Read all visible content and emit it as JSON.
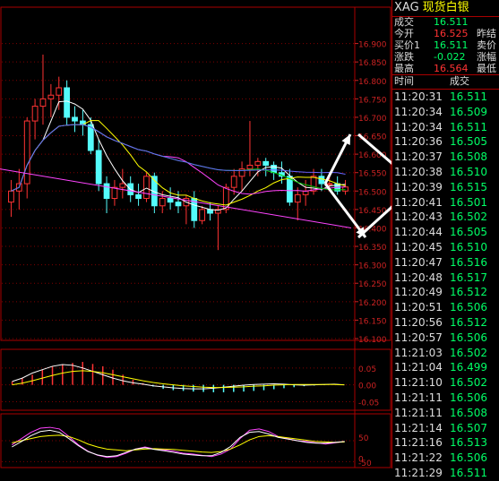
{
  "header": {
    "symbol": "XAG",
    "name": "现货白银"
  },
  "quote": [
    {
      "label": "成交",
      "value": "16.511",
      "color": "#00ff66",
      "label2": ""
    },
    {
      "label": "今开",
      "value": "16.525",
      "color": "#ff3333",
      "label2": "昨结"
    },
    {
      "label": "买价1",
      "value": "16.511",
      "color": "#00ff66",
      "label2": "卖价"
    },
    {
      "label": "涨跌",
      "value": "-0.022",
      "color": "#00ff66",
      "label2": "涨幅"
    },
    {
      "label": "最高",
      "value": "16.564",
      "color": "#ff3333",
      "label2": "最低"
    }
  ],
  "trades_header": {
    "time": "时间",
    "price": "成交"
  },
  "trades": [
    {
      "time": "11:20:31",
      "price": "16.511",
      "color": "#00ff66"
    },
    {
      "time": "11:20:34",
      "price": "16.509",
      "color": "#00ff66"
    },
    {
      "time": "11:20:34",
      "price": "16.511",
      "color": "#00ff66"
    },
    {
      "time": "11:20:36",
      "price": "16.505",
      "color": "#00ff66"
    },
    {
      "time": "11:20:37",
      "price": "16.508",
      "color": "#00ff66"
    },
    {
      "time": "11:20:38",
      "price": "16.510",
      "color": "#00ff66"
    },
    {
      "time": "11:20:39",
      "price": "16.515",
      "color": "#00ff66"
    },
    {
      "time": "11:20:41",
      "price": "16.501",
      "color": "#00ff66"
    },
    {
      "time": "11:20:43",
      "price": "16.502",
      "color": "#00ff66"
    },
    {
      "time": "11:20:44",
      "price": "16.505",
      "color": "#00ff66"
    },
    {
      "time": "11:20:45",
      "price": "16.510",
      "color": "#00ff66"
    },
    {
      "time": "11:20:47",
      "price": "16.516",
      "color": "#00ff66"
    },
    {
      "time": "11:20:48",
      "price": "16.517",
      "color": "#00ff66"
    },
    {
      "time": "11:20:49",
      "price": "16.512",
      "color": "#00ff66"
    },
    {
      "time": "11:20:51",
      "price": "16.506",
      "color": "#00ff66"
    },
    {
      "time": "11:20:56",
      "price": "16.512",
      "color": "#00ff66"
    },
    {
      "time": "11:20:57",
      "price": "16.506",
      "color": "#00ff66"
    },
    {
      "time": "11:21:03",
      "price": "16.502",
      "color": "#00ff66"
    },
    {
      "time": "11:21:04",
      "price": "16.499",
      "color": "#00ff66"
    },
    {
      "time": "11:21:10",
      "price": "16.502",
      "color": "#00ff66"
    },
    {
      "time": "11:21:11",
      "price": "16.506",
      "color": "#00ff66"
    },
    {
      "time": "11:21:11",
      "price": "16.508",
      "color": "#00ff66"
    },
    {
      "time": "11:21:14",
      "price": "16.507",
      "color": "#00ff66"
    },
    {
      "time": "11:21:16",
      "price": "16.513",
      "color": "#00ff66"
    },
    {
      "time": "11:21:22",
      "price": "16.506",
      "color": "#00ff66"
    },
    {
      "time": "11:21:29",
      "price": "16.511",
      "color": "#00ff66"
    }
  ],
  "chart_data": {
    "type": "candlestick",
    "ylim": [
      16.1,
      16.95
    ],
    "y_ticks": [
      "16.900",
      "16.850",
      "16.800",
      "16.750",
      "16.700",
      "16.650",
      "16.600",
      "16.550",
      "16.500",
      "16.450",
      "16.400",
      "16.350",
      "16.300",
      "16.250",
      "16.200",
      "16.150",
      "16.100"
    ],
    "grid": true,
    "candles": [
      {
        "o": 16.47,
        "h": 16.53,
        "l": 16.43,
        "c": 16.5
      },
      {
        "o": 16.5,
        "h": 16.56,
        "l": 16.45,
        "c": 16.52
      },
      {
        "o": 16.52,
        "h": 16.7,
        "l": 16.48,
        "c": 16.69
      },
      {
        "o": 16.69,
        "h": 16.75,
        "l": 16.64,
        "c": 16.73
      },
      {
        "o": 16.73,
        "h": 16.87,
        "l": 16.68,
        "c": 16.75
      },
      {
        "o": 16.75,
        "h": 16.79,
        "l": 16.7,
        "c": 16.76
      },
      {
        "o": 16.76,
        "h": 16.81,
        "l": 16.72,
        "c": 16.78
      },
      {
        "o": 16.78,
        "h": 16.8,
        "l": 16.68,
        "c": 16.7
      },
      {
        "o": 16.7,
        "h": 16.73,
        "l": 16.66,
        "c": 16.69
      },
      {
        "o": 16.69,
        "h": 16.72,
        "l": 16.65,
        "c": 16.68
      },
      {
        "o": 16.68,
        "h": 16.7,
        "l": 16.6,
        "c": 16.61
      },
      {
        "o": 16.61,
        "h": 16.64,
        "l": 16.5,
        "c": 16.52
      },
      {
        "o": 16.52,
        "h": 16.54,
        "l": 16.44,
        "c": 16.48
      },
      {
        "o": 16.48,
        "h": 16.53,
        "l": 16.46,
        "c": 16.51
      },
      {
        "o": 16.51,
        "h": 16.56,
        "l": 16.48,
        "c": 16.52
      },
      {
        "o": 16.52,
        "h": 16.54,
        "l": 16.47,
        "c": 16.49
      },
      {
        "o": 16.49,
        "h": 16.52,
        "l": 16.46,
        "c": 16.48
      },
      {
        "o": 16.48,
        "h": 16.55,
        "l": 16.47,
        "c": 16.54
      },
      {
        "o": 16.54,
        "h": 16.55,
        "l": 16.44,
        "c": 16.46
      },
      {
        "o": 16.46,
        "h": 16.5,
        "l": 16.44,
        "c": 16.48
      },
      {
        "o": 16.48,
        "h": 16.51,
        "l": 16.45,
        "c": 16.47
      },
      {
        "o": 16.47,
        "h": 16.5,
        "l": 16.44,
        "c": 16.46
      },
      {
        "o": 16.46,
        "h": 16.49,
        "l": 16.41,
        "c": 16.48
      },
      {
        "o": 16.48,
        "h": 16.5,
        "l": 16.4,
        "c": 16.42
      },
      {
        "o": 16.42,
        "h": 16.46,
        "l": 16.41,
        "c": 16.45
      },
      {
        "o": 16.45,
        "h": 16.47,
        "l": 16.42,
        "c": 16.44
      },
      {
        "o": 16.44,
        "h": 16.46,
        "l": 16.34,
        "c": 16.45
      },
      {
        "o": 16.45,
        "h": 16.52,
        "l": 16.44,
        "c": 16.51
      },
      {
        "o": 16.51,
        "h": 16.56,
        "l": 16.49,
        "c": 16.54
      },
      {
        "o": 16.54,
        "h": 16.58,
        "l": 16.5,
        "c": 16.56
      },
      {
        "o": 16.56,
        "h": 16.69,
        "l": 16.54,
        "c": 16.57
      },
      {
        "o": 16.57,
        "h": 16.59,
        "l": 16.54,
        "c": 16.58
      },
      {
        "o": 16.58,
        "h": 16.59,
        "l": 16.54,
        "c": 16.57
      },
      {
        "o": 16.57,
        "h": 16.58,
        "l": 16.53,
        "c": 16.55
      },
      {
        "o": 16.55,
        "h": 16.58,
        "l": 16.52,
        "c": 16.54
      },
      {
        "o": 16.54,
        "h": 16.56,
        "l": 16.46,
        "c": 16.47
      },
      {
        "o": 16.47,
        "h": 16.51,
        "l": 16.42,
        "c": 16.49
      },
      {
        "o": 16.49,
        "h": 16.53,
        "l": 16.46,
        "c": 16.5
      },
      {
        "o": 16.5,
        "h": 16.56,
        "l": 16.49,
        "c": 16.54
      },
      {
        "o": 16.54,
        "h": 16.56,
        "l": 16.5,
        "c": 16.52
      },
      {
        "o": 16.52,
        "h": 16.55,
        "l": 16.5,
        "c": 16.52
      },
      {
        "o": 16.52,
        "h": 16.54,
        "l": 16.49,
        "c": 16.5
      },
      {
        "o": 16.5,
        "h": 16.53,
        "l": 16.49,
        "c": 16.511
      }
    ],
    "indicator1": {
      "ylim": [
        -0.07,
        0.1
      ],
      "y_ticks": [
        "0.05",
        "0.00",
        "-0.05"
      ],
      "bars": [
        0.01,
        0.02,
        0.03,
        0.045,
        0.055,
        0.06,
        0.065,
        0.068,
        0.062,
        0.055,
        0.045,
        0.03,
        0.015,
        0.005,
        -0.005,
        -0.012,
        -0.016,
        -0.018,
        -0.02,
        -0.021,
        -0.022,
        -0.022,
        -0.021,
        -0.02,
        -0.018,
        -0.016,
        -0.013,
        -0.01,
        -0.007,
        -0.004,
        -0.002,
        -0.001,
        0.0,
        0.0
      ],
      "line1": [
        0.01,
        0.02,
        0.035,
        0.045,
        0.055,
        0.06,
        0.058,
        0.05,
        0.04,
        0.03,
        0.02,
        0.012,
        0.006,
        0.002,
        -0.003,
        -0.006,
        -0.009,
        -0.011,
        -0.012,
        -0.012,
        -0.01,
        -0.007,
        -0.004,
        -0.001,
        0.001,
        0.002,
        0.003,
        0.002,
        0.0,
        -0.001,
        0.0,
        0.001,
        0.002,
        0.0
      ],
      "line2": [
        0.0,
        0.005,
        0.012,
        0.02,
        0.028,
        0.035,
        0.04,
        0.042,
        0.04,
        0.036,
        0.03,
        0.024,
        0.018,
        0.012,
        0.007,
        0.003,
        0.0,
        -0.003,
        -0.005,
        -0.007,
        -0.008,
        -0.008,
        -0.007,
        -0.006,
        -0.004,
        -0.003,
        -0.001,
        0.0,
        0.001,
        0.001,
        0.001,
        0.001,
        0.001,
        0.0
      ]
    },
    "indicator2": {
      "ylim": [
        -10,
        110
      ],
      "y_ticks": [
        "50",
        "0",
        "-50"
      ],
      "line_purple": [
        40,
        55,
        70,
        80,
        82,
        78,
        60,
        40,
        25,
        15,
        10,
        12,
        20,
        30,
        35,
        30,
        28,
        25,
        20,
        18,
        15,
        12,
        18,
        30,
        55,
        75,
        78,
        72,
        60,
        55,
        50,
        48,
        45,
        42,
        45,
        48
      ],
      "line_yellow": [
        45,
        50,
        55,
        60,
        62,
        63,
        60,
        52,
        42,
        35,
        30,
        28,
        26,
        28,
        30,
        31,
        30,
        29,
        27,
        25,
        23,
        22,
        24,
        30,
        40,
        52,
        60,
        62,
        60,
        57,
        54,
        51,
        48,
        47,
        46,
        47
      ],
      "line_white": [
        35,
        48,
        62,
        72,
        75,
        70,
        55,
        38,
        24,
        16,
        12,
        14,
        22,
        30,
        33,
        29,
        26,
        22,
        18,
        16,
        14,
        14,
        22,
        36,
        58,
        70,
        72,
        66,
        58,
        54,
        50,
        46,
        44,
        44,
        46,
        48
      ]
    }
  },
  "colors": {
    "up": "#ff3333",
    "down": "#54fcfc",
    "grid": "#800000",
    "axis_text": "#cc2222",
    "ma_white": "#ffffff",
    "ma_yellow": "#ffff00",
    "ma_purple": "#ff44ff",
    "ma_green": "#00cc00",
    "ma_blue": "#6666ff"
  }
}
